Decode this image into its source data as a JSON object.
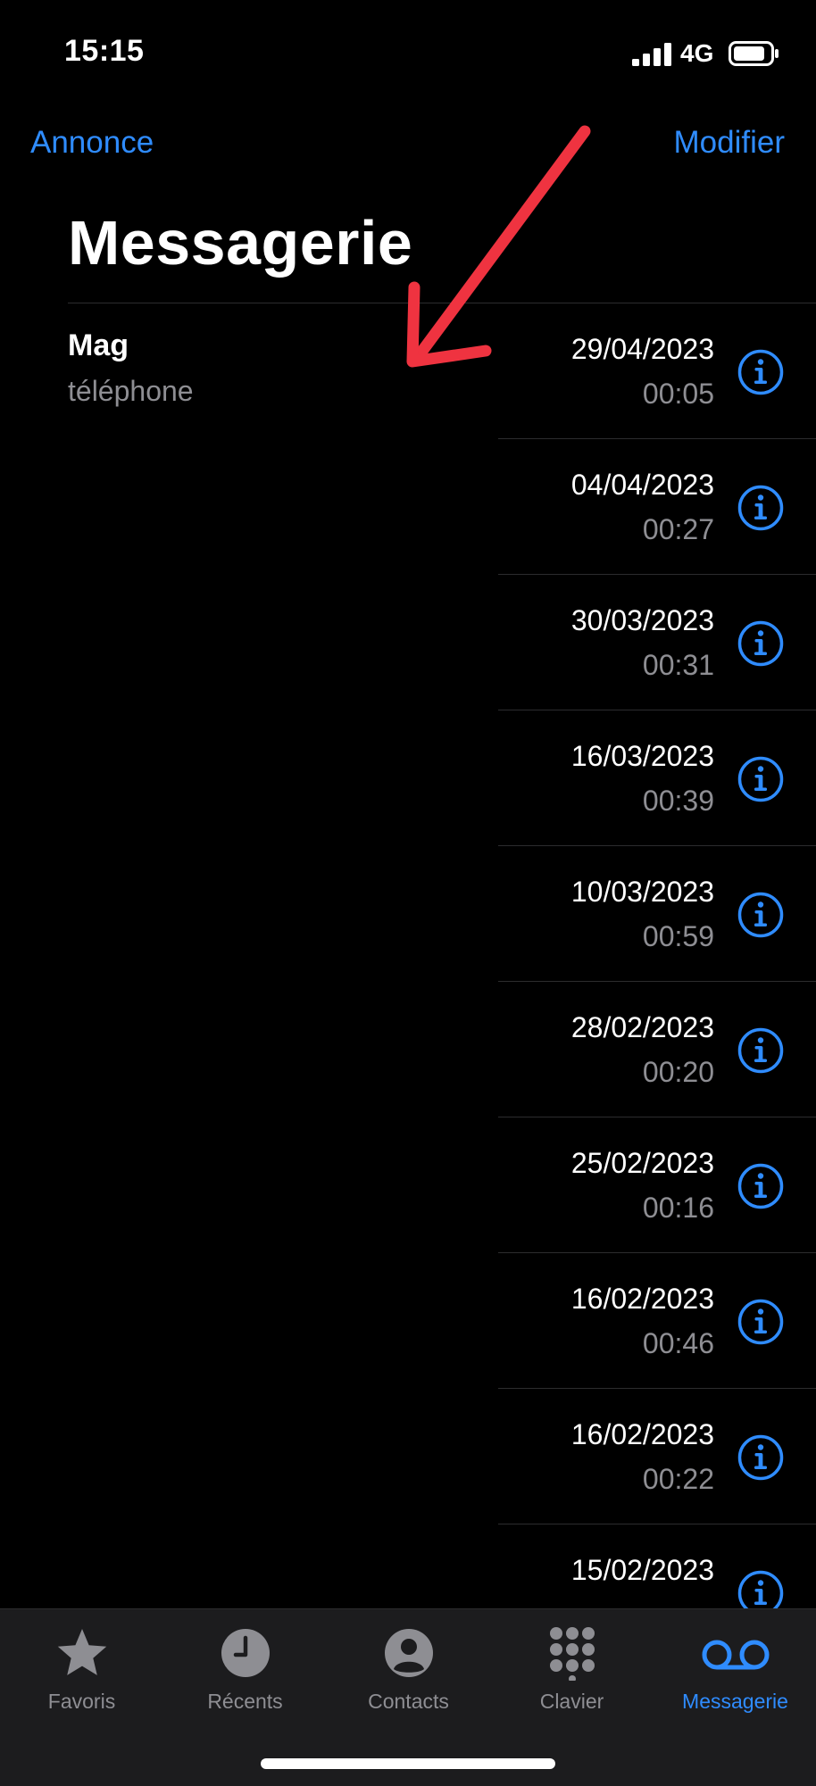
{
  "status": {
    "time": "15:15",
    "network": "4G"
  },
  "nav": {
    "left_label": "Annonce",
    "right_label": "Modifier",
    "title": "Messagerie"
  },
  "first_message": {
    "caller": "Mag",
    "label": "téléphone"
  },
  "messages": [
    {
      "date": "29/04/2023",
      "duration": "00:05"
    },
    {
      "date": "04/04/2023",
      "duration": "00:27"
    },
    {
      "date": "30/03/2023",
      "duration": "00:31"
    },
    {
      "date": "16/03/2023",
      "duration": "00:39"
    },
    {
      "date": "10/03/2023",
      "duration": "00:59"
    },
    {
      "date": "28/02/2023",
      "duration": "00:20"
    },
    {
      "date": "25/02/2023",
      "duration": "00:16"
    },
    {
      "date": "16/02/2023",
      "duration": "00:46"
    },
    {
      "date": "16/02/2023",
      "duration": "00:22"
    },
    {
      "date": "15/02/2023",
      "duration": ""
    }
  ],
  "tabs": [
    {
      "label": "Favoris",
      "icon": "star-icon"
    },
    {
      "label": "Récents",
      "icon": "clock-icon"
    },
    {
      "label": "Contacts",
      "icon": "person-icon"
    },
    {
      "label": "Clavier",
      "icon": "keypad-icon"
    },
    {
      "label": "Messagerie",
      "icon": "voicemail-icon",
      "active": true
    }
  ],
  "colors": {
    "accent": "#2f8cff",
    "secondary_text": "#8e8e93",
    "annotation_arrow": "#ef3340"
  }
}
